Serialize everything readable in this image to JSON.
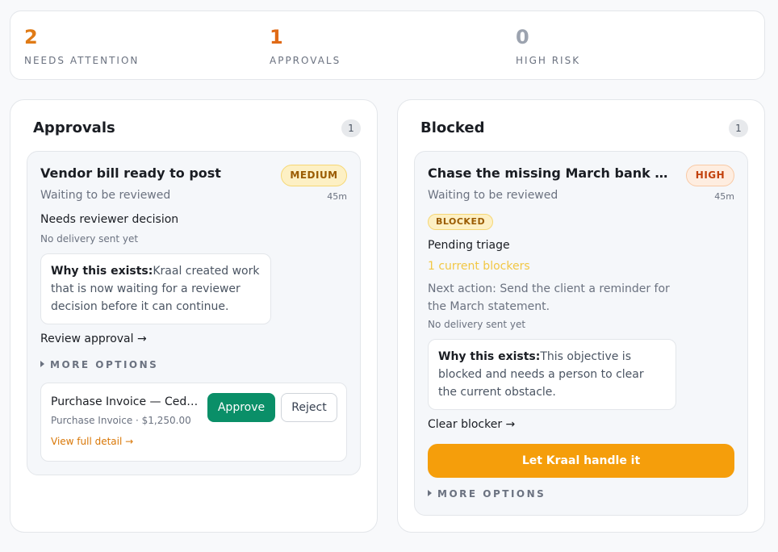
{
  "summary": {
    "needs_attention": {
      "value": "2",
      "label": "NEEDS ATTENTION",
      "color": "#e07b16"
    },
    "approvals": {
      "value": "1",
      "label": "APPROVALS",
      "color": "#e06a16"
    },
    "high_risk": {
      "value": "0",
      "label": "HIGH RISK",
      "color": "#9ca3af"
    }
  },
  "approvals_panel": {
    "title": "Approvals",
    "count": "1",
    "card": {
      "title": "Vendor bill ready to post",
      "severity": "MEDIUM",
      "status": "Waiting to be reviewed",
      "age": "45m",
      "decision": "Needs reviewer decision",
      "delivery": "No delivery sent yet",
      "why_label": "Why this exists:",
      "why_text": "Kraal created work that is now waiting for a reviewer decision before it can continue.",
      "action_link": "Review approval →",
      "more_options": "MORE OPTIONS",
      "item": {
        "title": "Purchase Invoice — Cedar Supplies",
        "meta": "Purchase Invoice · $1,250.00",
        "detail_link": "View full detail →",
        "approve_label": "Approve",
        "reject_label": "Reject"
      }
    }
  },
  "blocked_panel": {
    "title": "Blocked",
    "count": "1",
    "card": {
      "title": "Chase the missing March bank statement",
      "severity": "HIGH",
      "status": "Waiting to be reviewed",
      "age": "45m",
      "tag": "BLOCKED",
      "triage": "Pending triage",
      "blockers": "1 current blockers",
      "next_action": "Next action: Send the client a reminder for the March statement.",
      "delivery": "No delivery sent yet",
      "why_label": "Why this exists:",
      "why_text": "This objective is blocked and needs a person to clear the current obstacle.",
      "action_link": "Clear blocker →",
      "handle_label": "Let Kraal handle it",
      "more_options": "MORE OPTIONS"
    }
  },
  "colors": {
    "accent": "#f59e0b",
    "approve": "#0a8f68",
    "link": "#d97706"
  }
}
